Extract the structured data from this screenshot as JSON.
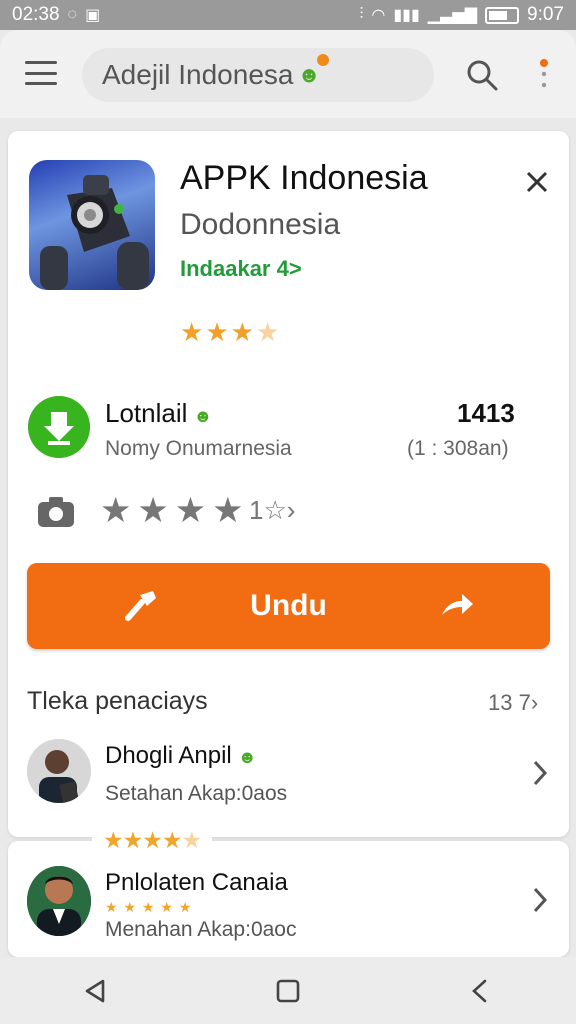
{
  "status_bar": {
    "time_left": "02:38",
    "time_right": "9:07"
  },
  "search": {
    "placeholder": "Adejil Indonesa"
  },
  "app": {
    "title": "APPK Indonesia",
    "developer": "Dodonnesia",
    "tag": "Indaakar 4>",
    "rating_stars": 3.5
  },
  "install": {
    "label": "Lotnlail",
    "subtitle": "Nomy Onumarnesia",
    "count": "1413",
    "time": "(1 : 308an)"
  },
  "rating": {
    "count": "1"
  },
  "download": {
    "label": "Undu"
  },
  "reviews": {
    "title": "Tleka penaciays",
    "count": "13 7",
    "items": [
      {
        "name": "Dhogli Anpil",
        "subtitle": "Setahan Akap:0aos",
        "stars": 4.5
      },
      {
        "name": "Pnlolaten Canaia",
        "subtitle": "Menahan Akap:0aoc",
        "stars": 5
      }
    ]
  },
  "colors": {
    "accent": "#f26c12",
    "green": "#38b41f",
    "star": "#f3a02a",
    "link_green": "#249b3a"
  }
}
